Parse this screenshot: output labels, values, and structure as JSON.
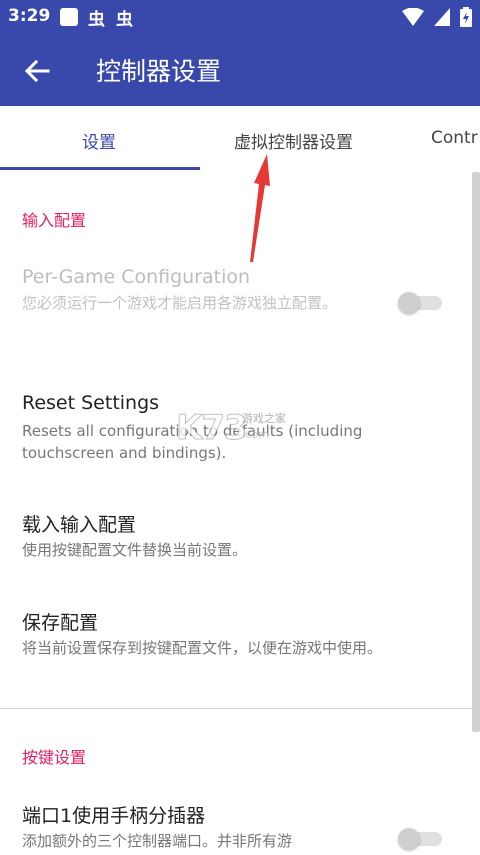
{
  "status_bar": {
    "time": "3:29",
    "notif_icons": [
      "虫",
      "虫"
    ]
  },
  "toolbar": {
    "title": "控制器设置"
  },
  "tabs": [
    {
      "label": "设置",
      "active": true
    },
    {
      "label": "虚拟控制器设置",
      "active": false
    },
    {
      "label": "Contr",
      "active": false
    }
  ],
  "sections": {
    "input_config": "输入配置",
    "button_settings": "按键设置"
  },
  "prefs": {
    "per_game": {
      "title": "Per-Game Configuration",
      "summary": "您必须运行一个游戏才能启用各游戏独立配置。",
      "enabled": false,
      "switch_on": false
    },
    "reset": {
      "title": "Reset Settings",
      "summary": "Resets all configuration to defaults (including touchscreen and bindings)."
    },
    "load": {
      "title": "载入输入配置",
      "summary": "使用按键配置文件替换当前设置。"
    },
    "save": {
      "title": "保存配置",
      "summary": "将当前设置保存到按键配置文件，以便在游戏中使用。"
    },
    "port1": {
      "title": "端口1使用手柄分插器",
      "summary": "添加额外的三个控制器端口。并非所有游",
      "switch_on": false
    }
  },
  "watermark": {
    "logo": "K73",
    "cn": "游戏之家",
    "com": ".com"
  },
  "colors": {
    "primary": "#3949ab",
    "accent": "#e91e63",
    "arrow": "#e53935"
  }
}
